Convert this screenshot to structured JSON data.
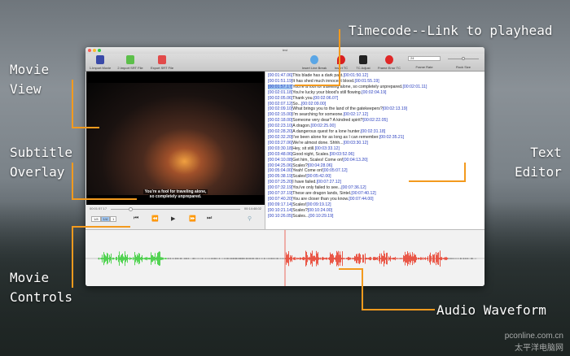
{
  "window": {
    "title": "test"
  },
  "toolbar": {
    "import_movie": "1.Import Movie",
    "import_srt": "2.Import SRT File",
    "export_srt": "Export SRT File",
    "insert_line_break": "Insert Line Break",
    "insert_tc": "Insert TC",
    "tc_adjust": "TC Adjust",
    "frame_error_tc": "Frame Error TC",
    "frame_rate_label": "Frame Rate",
    "frame_rate_value": "24",
    "zoom_label": "Rock Size"
  },
  "player": {
    "current_time": "00:01:57.17",
    "duration": "00:14:48.02",
    "progress": 0.13,
    "rates": [
      "1/8",
      "1/4",
      "1"
    ],
    "selected_rate": "1/4",
    "subtitle": [
      "You're a fool for traveling alone,",
      "so completely unprepared."
    ]
  },
  "editor": {
    "lines": [
      {
        "start": "[00:01:47.06]",
        "text": "This blade has a dark past.",
        "end": "[00:01:50.12]"
      },
      {
        "start": "[00:01:51.19]",
        "text": "It has shed much innocent blood.",
        "end": "[00:01:55.19]"
      },
      {
        "start": "[00:01:57.17]",
        "text": "You're a fool for traveling alone, so completely unprepared.",
        "end": "[00:02:01.11]"
      },
      {
        "start": "[00:02:01.18]",
        "text": "You're lucky your blood's still flowing.",
        "end": "[00:02:04.19]"
      },
      {
        "start": "[00:02:05.06]",
        "text": "Thank you.",
        "end": "[00:02:06.07]"
      },
      {
        "start": "[00:02:07.12]",
        "text": "So...",
        "end": "[00:02:09.00]"
      },
      {
        "start": "[00:02:09.10]",
        "text": "What brings you to the land of the gatekeepers?",
        "end": "[00:02:13.19]"
      },
      {
        "start": "[00:02:15.00]",
        "text": "I'm searching for someone.",
        "end": "[00:02:17.12]"
      },
      {
        "start": "[00:02:18.00]",
        "text": "Someone very dear? A kindred spirit?",
        "end": "[00:02:22.05]"
      },
      {
        "start": "[00:02:23.10]",
        "text": "A dragon.",
        "end": "[00:02:25.00]"
      },
      {
        "start": "[00:02:28.20]",
        "text": "A dangerous quest for a lone hunter.",
        "end": "[00:02:31.18]"
      },
      {
        "start": "[00:02:32.20]",
        "text": "I've been alone for as long as I can remember.",
        "end": "[00:02:35.21]"
      },
      {
        "start": "[00:03:27.06]",
        "text": "We're almost done. Shhh...",
        "end": "[00:03:30.12]"
      },
      {
        "start": "[00:03:30.18]",
        "text": "Hey, sit still.",
        "end": "[00:03:33.12]"
      },
      {
        "start": "[00:03:48.06]",
        "text": "Good night, Scales.",
        "end": "[00:03:52.06]"
      },
      {
        "start": "[00:04:10.08]",
        "text": "Get him, Scales! Come on!",
        "end": "[00:04:13.20]"
      },
      {
        "start": "[00:04:25.06]",
        "text": "Scales?",
        "end": "[00:04:28.06]"
      },
      {
        "start": "[00:05:04.00]",
        "text": "Yeah! Come on!",
        "end": "[00:05:07.12]"
      },
      {
        "start": "[00:05:38.19]",
        "text": "Scales!",
        "end": "[00:05:42.00]"
      },
      {
        "start": "[00:07:25.20]",
        "text": "I have failed.",
        "end": "[00:07:27.12]"
      },
      {
        "start": "[00:07:32.19]",
        "text": "You've only failed to see...",
        "end": "[00:07:36.12]"
      },
      {
        "start": "[00:07:37.19]",
        "text": "These are dragon lands, Sintel.",
        "end": "[00:07:40.12]"
      },
      {
        "start": "[00:07:40.20]",
        "text": "You are closer than you know.",
        "end": "[00:07:44.00]"
      },
      {
        "start": "[00:09:17.14]",
        "text": "Scales!",
        "end": "[00:09:19.12]"
      },
      {
        "start": "[00:10:21.14]",
        "text": "Scales?",
        "end": "[00:10:24.00]"
      },
      {
        "start": "[00:10:26.05]",
        "text": "Scales...",
        "end": "[00:10:29.19]"
      }
    ]
  },
  "annotations": {
    "movie_view": [
      "Movie",
      "View"
    ],
    "subtitle_overlay": [
      "Subtitle",
      "Overlay"
    ],
    "movie_controls": [
      "Movie",
      "Controls"
    ],
    "timecode": "Timecode--Link to playhead",
    "text_editor": [
      "Text",
      "Editor"
    ],
    "audio_waveform": "Audio Waveform"
  },
  "watermark": [
    "pconline.com.cn",
    "太平洋电脑网"
  ],
  "colors": {
    "accent": "#f39a1e",
    "timecode": "#2a3fbf",
    "wave_played": "#2ecc2e",
    "wave_current": "#e8321e"
  }
}
